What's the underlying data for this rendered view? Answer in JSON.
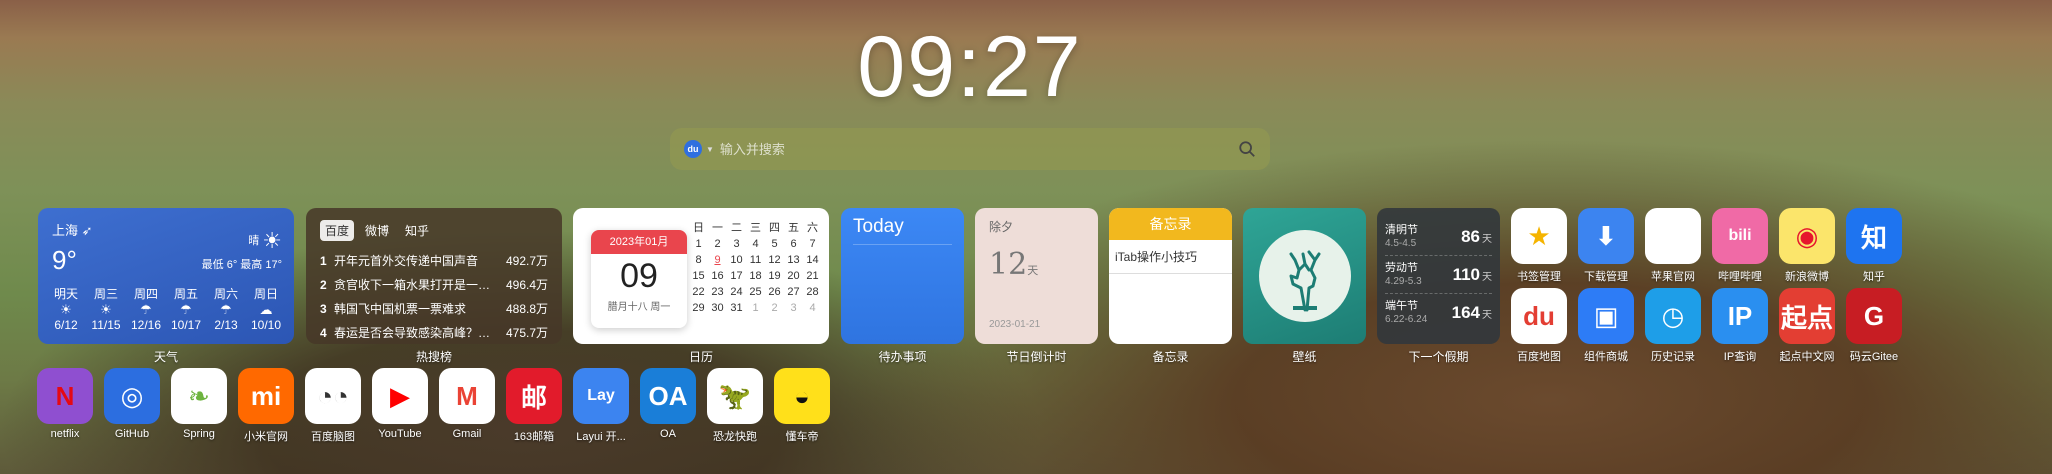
{
  "clock": "09:27",
  "search": {
    "placeholder": "输入并搜索",
    "engine": "du"
  },
  "weather": {
    "label": "天气",
    "city": "上海",
    "temp": "9°",
    "condition": "晴",
    "range": "最低 6° 最高 17°",
    "days": [
      {
        "name": "明天",
        "icon": "sun",
        "date": "6/12"
      },
      {
        "name": "周三",
        "icon": "sun",
        "date": "11/15"
      },
      {
        "name": "周四",
        "icon": "rain",
        "date": "12/16"
      },
      {
        "name": "周五",
        "icon": "rain",
        "date": "10/17"
      },
      {
        "name": "周六",
        "icon": "rain",
        "date": "2/13"
      },
      {
        "name": "周日",
        "icon": "cloud",
        "date": "10/10"
      }
    ]
  },
  "hot": {
    "label": "热搜榜",
    "tabs": [
      "百度",
      "微博",
      "知乎"
    ],
    "items": [
      {
        "n": "1",
        "title": "开年元首外交传递中国声音",
        "value": "492.7万"
      },
      {
        "n": "2",
        "title": "贪官收下一箱水果打开是一百万",
        "value": "496.4万"
      },
      {
        "n": "3",
        "title": "韩国飞中国机票一票难求",
        "value": "488.8万"
      },
      {
        "n": "4",
        "title": "春运是否会导致感染高峰？官方回应",
        "value": "475.7万"
      }
    ]
  },
  "calendar": {
    "label": "日历",
    "month": "2023年01月",
    "day": "09",
    "lunar": "腊月十八 周一",
    "weekdays": [
      "日",
      "一",
      "二",
      "三",
      "四",
      "五",
      "六"
    ],
    "cells": [
      "1",
      "2",
      "3",
      "4",
      "5",
      "6",
      "7",
      "8",
      "9",
      "10",
      "11",
      "12",
      "13",
      "14",
      "15",
      "16",
      "17",
      "18",
      "19",
      "20",
      "21",
      "22",
      "23",
      "24",
      "25",
      "26",
      "27",
      "28",
      "29",
      "30",
      "31",
      "1",
      "2",
      "3",
      "4"
    ]
  },
  "todo": {
    "label": "待办事项",
    "title": "Today"
  },
  "countdown": {
    "label": "节日倒计时",
    "name": "除夕",
    "days": "12",
    "unit": "天",
    "date": "2023-01-21"
  },
  "memo": {
    "label": "备忘录",
    "title": "备忘录",
    "item": "iTab操作小技巧"
  },
  "wallpaper": {
    "label": "壁纸"
  },
  "holiday": {
    "label": "下一个假期",
    "rows": [
      {
        "name": "清明节",
        "range": "4.5-4.5",
        "days": "86",
        "unit": "天"
      },
      {
        "name": "劳动节",
        "range": "4.29-5.3",
        "days": "110",
        "unit": "天"
      },
      {
        "name": "端午节",
        "range": "6.22-6.24",
        "days": "164",
        "unit": "天"
      }
    ]
  },
  "apps_right": [
    {
      "label": "书签管理",
      "icon": "star-icon",
      "bg": "#ffffff",
      "fg": "#f5b400",
      "glyph": "★"
    },
    {
      "label": "下载管理",
      "icon": "download-icon",
      "bg": "#3c84f0",
      "fg": "#ffffff",
      "glyph": "⬇"
    },
    {
      "label": "苹果官网",
      "icon": "apple-icon",
      "bg": "#ffffff",
      "fg": "#777777",
      "glyph": ""
    },
    {
      "label": "哔哩哔哩",
      "icon": "bilibili-icon",
      "bg": "#f06aa6",
      "fg": "#ffffff",
      "glyph": "bili"
    },
    {
      "label": "新浪微博",
      "icon": "weibo-icon",
      "bg": "#fbe56b",
      "fg": "#e6162d",
      "glyph": "◉"
    },
    {
      "label": "知乎",
      "icon": "zhihu-icon",
      "bg": "#1e74f0",
      "fg": "#ffffff",
      "glyph": "知"
    },
    {
      "label": "百度地图",
      "icon": "baidu-map-icon",
      "bg": "#ffffff",
      "fg": "#e33e33",
      "glyph": "du"
    },
    {
      "label": "组件商城",
      "icon": "store-icon",
      "bg": "#2d7cf6",
      "fg": "#ffffff",
      "glyph": "▣"
    },
    {
      "label": "历史记录",
      "icon": "clock-icon",
      "bg": "#1e9ee8",
      "fg": "#ffffff",
      "glyph": "◷"
    },
    {
      "label": "IP查询",
      "icon": "ip-icon",
      "bg": "#2a8ff0",
      "fg": "#ffffff",
      "glyph": "IP"
    },
    {
      "label": "起点中文网",
      "icon": "qidian-icon",
      "bg": "#e33e33",
      "fg": "#ffffff",
      "glyph": "起点"
    },
    {
      "label": "码云Gitee",
      "icon": "gitee-icon",
      "bg": "#c71d23",
      "fg": "#ffffff",
      "glyph": "G"
    }
  ],
  "apps_bottom": [
    {
      "label": "netflix",
      "icon": "netflix-icon",
      "bg": "#8f4fd0",
      "fg": "#e50914",
      "glyph": "N"
    },
    {
      "label": "GitHub",
      "icon": "github-icon",
      "bg": "#2c6ee0",
      "fg": "#ffffff",
      "glyph": "◎"
    },
    {
      "label": "Spring",
      "icon": "spring-icon",
      "bg": "#ffffff",
      "fg": "#6db33f",
      "glyph": "❧"
    },
    {
      "label": "小米官网",
      "icon": "mi-icon",
      "bg": "#ff6900",
      "fg": "#ffffff",
      "glyph": "mi"
    },
    {
      "label": "百度脑图",
      "icon": "naotu-icon",
      "bg": "#ffffff",
      "fg": "#333333",
      "glyph": "◔◔"
    },
    {
      "label": "YouTube",
      "icon": "youtube-icon",
      "bg": "#ffffff",
      "fg": "#ff0000",
      "glyph": "▶"
    },
    {
      "label": "Gmail",
      "icon": "gmail-icon",
      "bg": "#ffffff",
      "fg": "#ea4335",
      "glyph": "M"
    },
    {
      "label": "163邮箱",
      "icon": "mail163-icon",
      "bg": "#e21b2b",
      "fg": "#ffffff",
      "glyph": "邮"
    },
    {
      "label": "Layui 开...",
      "icon": "layui-icon",
      "bg": "#3c84f0",
      "fg": "#ffffff",
      "glyph": "Lay"
    },
    {
      "label": "OA",
      "icon": "oa-icon",
      "bg": "#1a7ed8",
      "fg": "#ffffff",
      "glyph": "OA"
    },
    {
      "label": "恐龙快跑",
      "icon": "dino-icon",
      "bg": "#ffffff",
      "fg": "#555555",
      "glyph": "🦖"
    },
    {
      "label": "懂车帝",
      "icon": "dongchedi-icon",
      "bg": "#ffe01a",
      "fg": "#111111",
      "glyph": "◒"
    }
  ]
}
